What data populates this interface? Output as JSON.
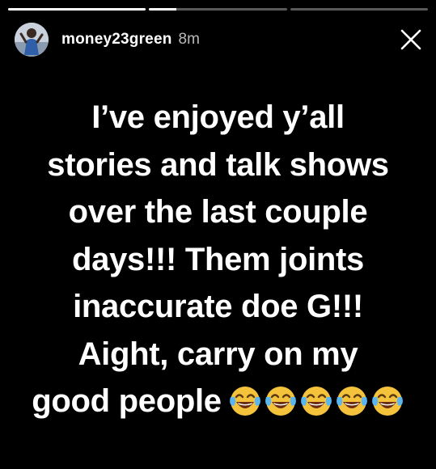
{
  "progress": [
    {
      "fill": 1.0
    },
    {
      "fill": 0.2
    },
    {
      "fill": 0.0
    }
  ],
  "header": {
    "username": "money23green",
    "timestamp": "8m"
  },
  "icons": {
    "avatar": "profile-photo",
    "close": "close-icon",
    "emoji": "face-with-tears-of-joy"
  },
  "story": {
    "lines": [
      "I’ve enjoyed y’all",
      "stories and talk shows",
      "over the last couple",
      "days!!! Them joints",
      "inaccurate doe G!!!",
      "Aight, carry on my",
      "good people"
    ],
    "emoji_count": 5
  },
  "colors": {
    "background": "#000000",
    "text": "#ffffff",
    "emoji_yellow": "#f5c33b"
  }
}
